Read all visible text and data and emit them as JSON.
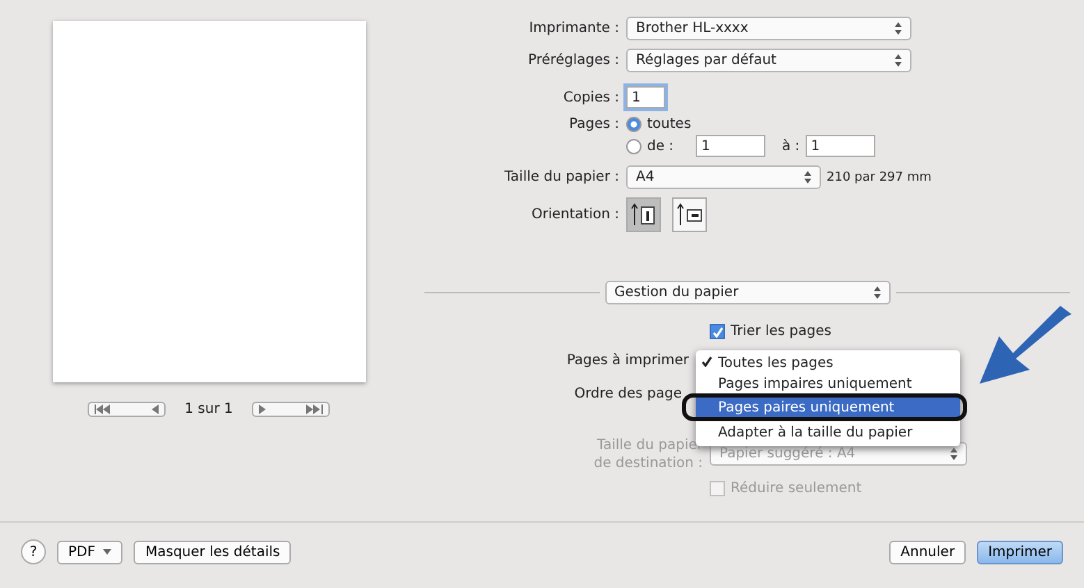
{
  "preview": {
    "page_counter": "1 sur 1"
  },
  "printer": {
    "label": "Imprimante :",
    "value": "Brother HL-xxxx"
  },
  "presets": {
    "label": "Préréglages :",
    "value": "Réglages par défaut"
  },
  "copies": {
    "label": "Copies :",
    "value": "1"
  },
  "pages": {
    "label": "Pages :",
    "options": [
      {
        "label": "toutes",
        "selected": true
      },
      {
        "label": "de :",
        "selected": false
      }
    ],
    "from": "1",
    "to_label": "à :",
    "to": "1"
  },
  "paper_size": {
    "label": "Taille du papier :",
    "value": "A4",
    "dimensions": "210 par 297 mm"
  },
  "orientation": {
    "label": "Orientation :",
    "options": [
      {
        "kind": "portrait",
        "selected": true
      },
      {
        "kind": "landscape",
        "selected": false
      }
    ]
  },
  "section_popup": "Gestion du papier",
  "collate": {
    "label": "Trier les pages",
    "checked": true
  },
  "pages_to_print": {
    "label": "Pages à imprimer"
  },
  "page_order": {
    "label": "Ordre des page"
  },
  "menu": [
    {
      "label": "Toutes les pages",
      "checked": true,
      "selected": false
    },
    {
      "label": "Pages impaires uniquement",
      "checked": false,
      "selected": false
    },
    {
      "label": "Pages paires uniquement",
      "checked": false,
      "selected": true
    },
    {
      "label": "Adapter à la taille du papier",
      "checked": false,
      "selected": false
    }
  ],
  "destination_size": {
    "label_lines": [
      "Taille du papier",
      "de destination :"
    ],
    "value": "Papier suggéré : A4",
    "disabled": true
  },
  "scale_down": {
    "label": "Réduire seulement",
    "checked": false,
    "disabled": true
  },
  "footer": {
    "help": "?",
    "pdf": "PDF",
    "details": "Masquer les détails",
    "cancel": "Annuler",
    "print": "Imprimer"
  }
}
